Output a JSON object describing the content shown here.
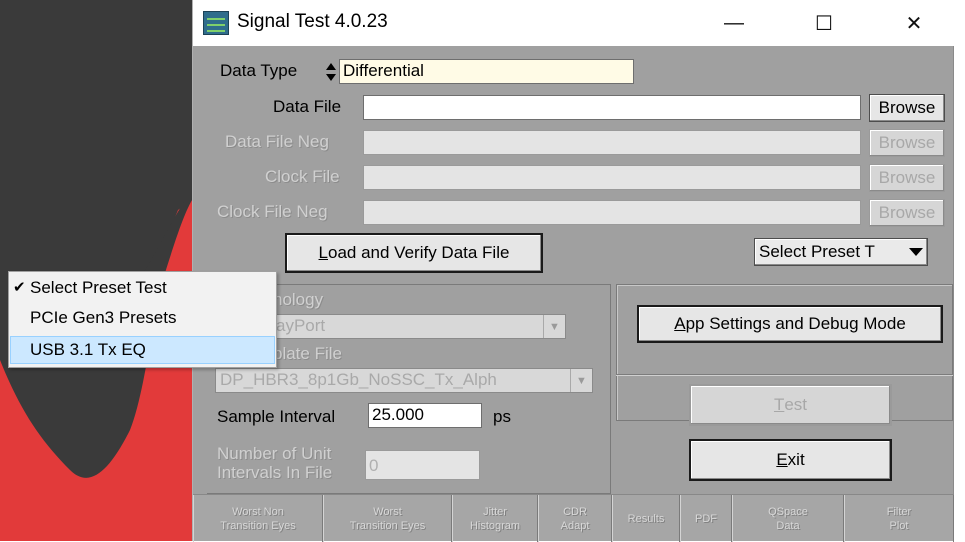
{
  "window": {
    "title": "Signal Test 4.0.23",
    "minimize_glyph": "—",
    "maximize_glyph": "☐",
    "close_glyph": "✕"
  },
  "form": {
    "data_type_label": "Data Type",
    "data_type_value": "Differential",
    "data_file_label": "Data File",
    "data_file_value": "",
    "data_file_neg_label": "Data File Neg",
    "clock_file_label": "Clock File",
    "clock_file_neg_label": "Clock File Neg",
    "browse_label": "Browse",
    "load_verify_label": "Load and Verify Data File",
    "load_verify_mnemonic": "L",
    "load_verify_rest": "oad and Verify Data File",
    "select_preset_label": "Select Preset T",
    "technology_label": "Technology",
    "technology_visible": "nology",
    "technology_value": "DisplayPort",
    "technology_visible_value": "ayPort",
    "template_label": "Template File",
    "template_visible": "plate File",
    "template_value": "DP_HBR3_8p1Gb_NoSSC_Tx_Alph",
    "sample_interval_label": "Sample Interval",
    "sample_interval_value": "25.000",
    "sample_interval_unit": "ps",
    "num_ui_label_line1": "Number of Unit",
    "num_ui_label_line2": "Intervals In File",
    "num_ui_value": "0"
  },
  "right_panel": {
    "app_settings_mnemonic": "A",
    "app_settings_rest": "pp Settings and Debug Mode",
    "test_mnemonic": "T",
    "test_rest": "est",
    "exit_mnemonic": "E",
    "exit_rest": "xit"
  },
  "tabs": [
    {
      "line1": "Worst Non",
      "line2": "Transition Eyes"
    },
    {
      "line1": "Worst",
      "line2": "Transition Eyes"
    },
    {
      "line1": "Jitter",
      "line2": "Histogram"
    },
    {
      "line1": "CDR",
      "line2": "Adapt"
    },
    {
      "line1": "Results",
      "line2": ""
    },
    {
      "line1": "PDF",
      "line2": ""
    },
    {
      "line1": "QSpace",
      "line2": "Data"
    },
    {
      "line1": "Filter",
      "line2": "Plot"
    }
  ],
  "menu": {
    "items": [
      {
        "label": "Select Preset Test",
        "checked": true
      },
      {
        "label": "PCIe Gen3 Presets",
        "checked": false
      },
      {
        "label": "USB 3.1 Tx EQ",
        "checked": false
      }
    ],
    "check_glyph": "✔"
  },
  "colors": {
    "client_bg": "#a0a0a0",
    "menu_highlight": "#cce8ff",
    "waveform": "#e23a3a"
  }
}
